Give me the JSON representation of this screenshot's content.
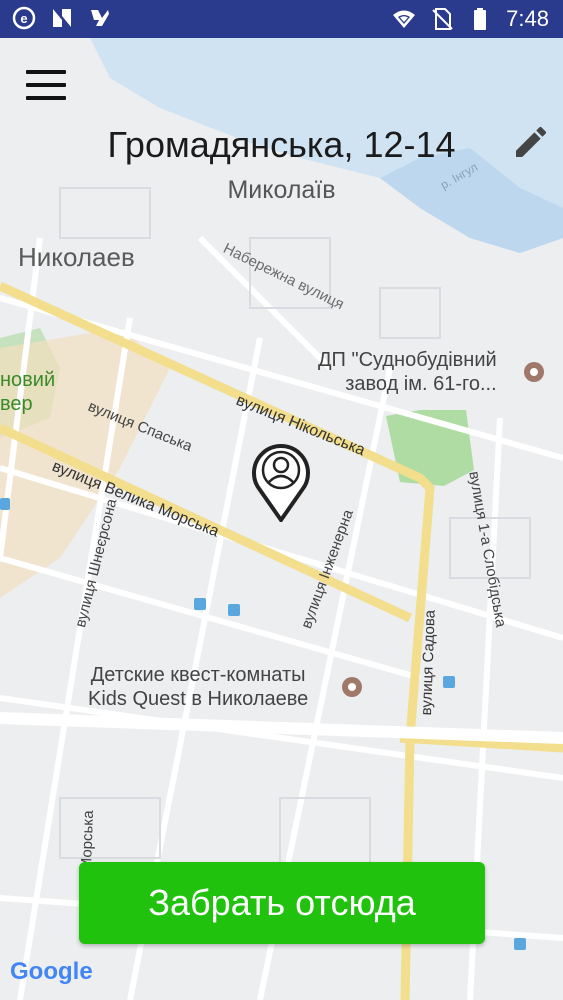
{
  "status_bar": {
    "icons": [
      "e-app-icon",
      "n-app-icon",
      "downloads-icon",
      "wifi-icon",
      "no-sim-icon",
      "battery-icon"
    ],
    "time": "7:48"
  },
  "header": {
    "title": "Громадянська, 12-14",
    "subtitle": "Миколаїв"
  },
  "map": {
    "city_label": "Николаев",
    "streets": {
      "naberezhna": "Набережна вулиця",
      "nikolska": "вулиця Нікольська",
      "spaska": "вулиця Спаська",
      "velyka_morska": "вулиця Велика Морська",
      "shneersona": "вулиця Шнеєрсона",
      "inzhenerna": "вулиця Інженерна",
      "sadova": "вулиця Садова",
      "slobidska": "вулиця 1-а Слобідська",
      "inhul": "р. Інгул",
      "morska_partial": "Морська"
    },
    "pois": {
      "shipyard_line1": "ДП \"Суднобудівний",
      "shipyard_line2": "завод ім. 61-го...",
      "quest_line1": "Детские квест-комнаты",
      "quest_line2": "Kids Quest в Николаеве"
    },
    "park_partial_line1": "новий",
    "park_partial_line2": "вер",
    "attribution": "Google"
  },
  "action": {
    "pickup_label": "Забрать отсюда"
  },
  "colors": {
    "status_bar": "#2a3a8c",
    "cta_green": "#20c20e",
    "road_yellow": "#f6e7a0",
    "water": "#c6dff2",
    "park": "#a7d99a"
  }
}
